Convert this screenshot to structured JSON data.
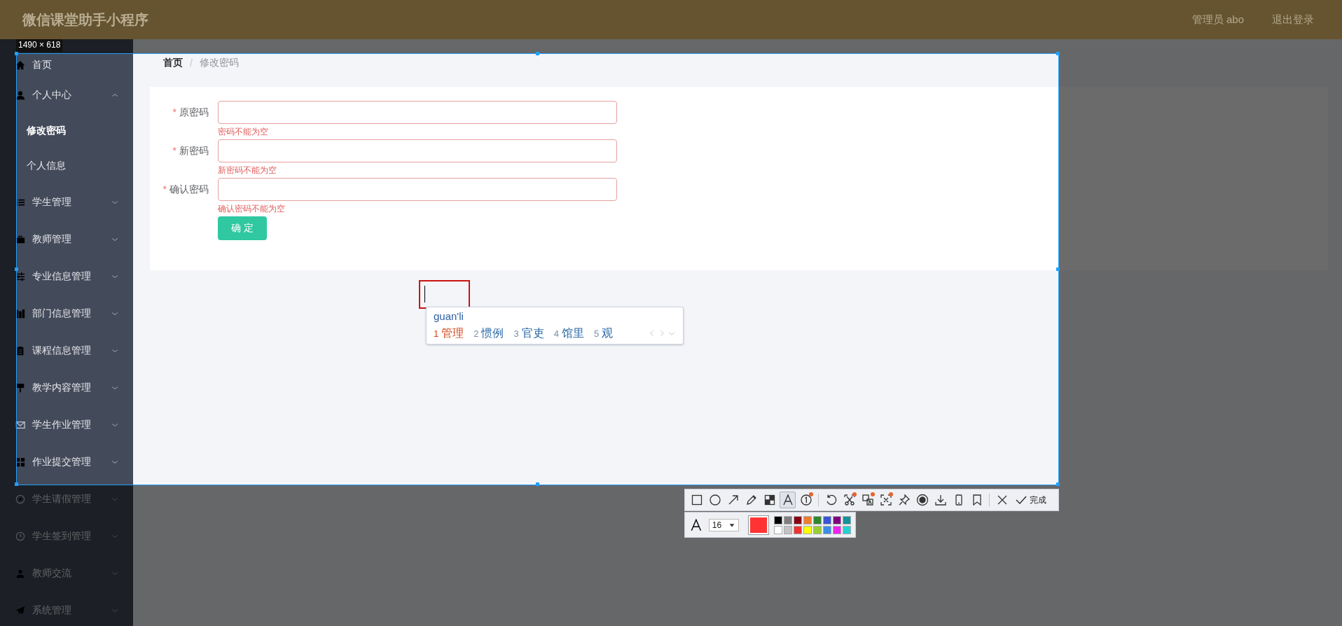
{
  "header": {
    "title": "微信课堂助手小程序",
    "user": "管理员 abo",
    "logout": "退出登录"
  },
  "sidebar": {
    "items": [
      {
        "label": "首页",
        "kind": "link",
        "selected": false
      },
      {
        "label": "个人中心",
        "kind": "menu",
        "selected": false,
        "expanded": true,
        "children": [
          {
            "label": "修改密码",
            "selected": true
          },
          {
            "label": "个人信息",
            "selected": false
          }
        ]
      },
      {
        "label": "学生管理",
        "kind": "menu",
        "selected": false,
        "expanded": false
      },
      {
        "label": "教师管理",
        "kind": "menu",
        "selected": false,
        "expanded": false
      },
      {
        "label": "专业信息管理",
        "kind": "menu",
        "selected": false,
        "expanded": false
      },
      {
        "label": "部门信息管理",
        "kind": "menu",
        "selected": false,
        "expanded": false
      },
      {
        "label": "课程信息管理",
        "kind": "menu",
        "selected": false,
        "expanded": false
      },
      {
        "label": "教学内容管理",
        "kind": "menu",
        "selected": false,
        "expanded": false
      },
      {
        "label": "学生作业管理",
        "kind": "menu",
        "selected": false,
        "expanded": false
      },
      {
        "label": "作业提交管理",
        "kind": "menu",
        "selected": false,
        "expanded": false
      },
      {
        "label": "学生请假管理",
        "kind": "menu",
        "selected": false,
        "expanded": false
      },
      {
        "label": "学生签到管理",
        "kind": "menu",
        "selected": false,
        "expanded": false
      },
      {
        "label": "教师交流",
        "kind": "menu",
        "selected": false,
        "expanded": false
      },
      {
        "label": "系统管理",
        "kind": "menu",
        "selected": false,
        "expanded": false
      }
    ]
  },
  "breadcrumb": {
    "items": [
      "首页",
      "修改密码"
    ],
    "separator": "/"
  },
  "form": {
    "fields": [
      {
        "marker": "*",
        "label": "原密码",
        "error": "密码不能为空"
      },
      {
        "marker": "*",
        "label": "新密码",
        "error": "新密码不能为空"
      },
      {
        "marker": "*",
        "label": "确认密码",
        "error": "确认密码不能为空"
      }
    ],
    "submit": "确 定"
  },
  "screenshot_tool": {
    "size_label": "1490 × 618",
    "tools": [
      {
        "selected": false,
        "badge": false
      },
      {
        "selected": false,
        "badge": false
      },
      {
        "selected": false,
        "badge": false
      },
      {
        "selected": false,
        "badge": false
      },
      {
        "selected": false,
        "badge": false
      },
      {
        "selected": true,
        "badge": false
      },
      {
        "selected": false,
        "badge": true
      },
      {
        "selected": false,
        "badge": false
      },
      {
        "selected": false,
        "badge": true
      },
      {
        "selected": false,
        "badge": true
      },
      {
        "selected": false,
        "badge": true
      },
      {
        "selected": false,
        "badge": false
      },
      {
        "selected": false,
        "badge": false
      },
      {
        "selected": false,
        "badge": false
      },
      {
        "selected": false,
        "badge": false
      },
      {
        "selected": false,
        "badge": false
      }
    ],
    "done": "完成",
    "font_size": "16",
    "current": {
      "color": "#ff3333"
    },
    "palette": [
      {
        "color": "#000000",
        "selected": false
      },
      {
        "color": "#7f7f7f",
        "selected": false
      },
      {
        "color": "#880015",
        "selected": false
      },
      {
        "color": "#ed7d31",
        "selected": false
      },
      {
        "color": "#31862e",
        "selected": false
      },
      {
        "color": "#3a55d6",
        "selected": false
      },
      {
        "color": "#800080",
        "selected": false
      },
      {
        "color": "#11949a",
        "selected": false
      },
      {
        "color": "#ffffff",
        "selected": false
      },
      {
        "color": "#c3c3c3",
        "selected": false
      },
      {
        "color": "#ee3333",
        "selected": false
      },
      {
        "color": "#ffff00",
        "selected": false
      },
      {
        "color": "#9acd32",
        "selected": false
      },
      {
        "color": "#3a8ee6",
        "selected": false
      },
      {
        "color": "#ee22ee",
        "selected": false
      },
      {
        "color": "#22d3d3",
        "selected": false
      }
    ]
  },
  "ime": {
    "composition": "guan'li",
    "candidates": [
      {
        "number": "1",
        "text": "管理",
        "selected": true
      },
      {
        "number": "2",
        "text": "惯例",
        "selected": false
      },
      {
        "number": "3",
        "text": "官吏",
        "selected": false
      },
      {
        "number": "4",
        "text": "馆里",
        "selected": false
      },
      {
        "number": "5",
        "text": "观",
        "selected": false
      }
    ]
  }
}
